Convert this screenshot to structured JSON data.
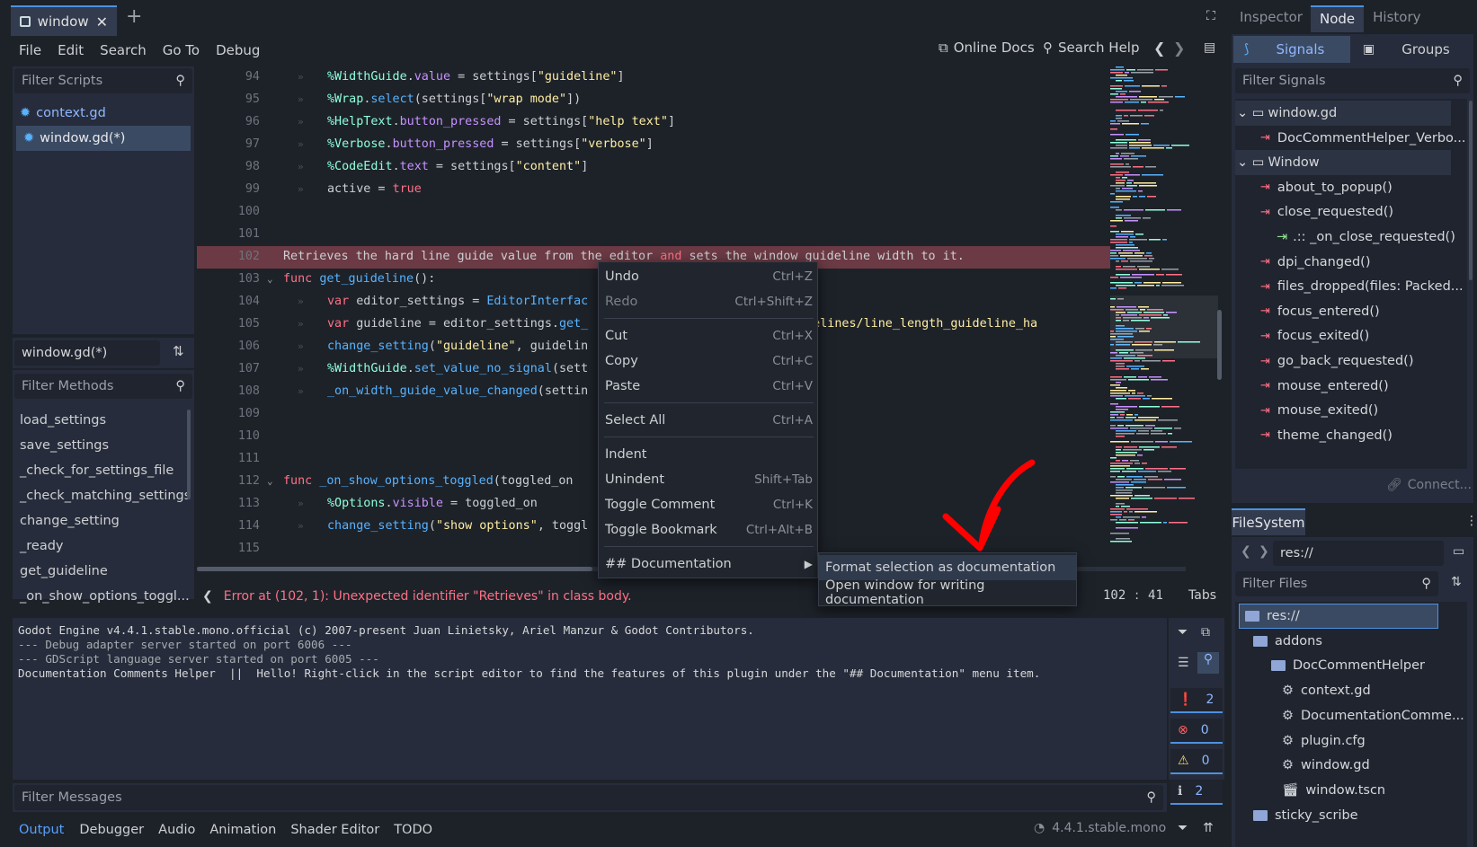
{
  "tabs": {
    "doc_tab": "window",
    "add": "+"
  },
  "menu": [
    "File",
    "Edit",
    "Search",
    "Go To",
    "Debug"
  ],
  "toolbar": {
    "online_docs": "Online Docs",
    "search_help": "Search Help"
  },
  "scripts_panel": {
    "filter_placeholder": "Filter Scripts",
    "items": [
      "context.gd",
      "window.gd(*)"
    ],
    "current": "window.gd(*)",
    "filter_methods": "Filter Methods",
    "methods": [
      "load_settings",
      "save_settings",
      "_check_for_settings_file",
      "_check_matching_settings",
      "change_setting",
      "_ready",
      "get_guideline",
      "_on_show_options_toggl..."
    ]
  },
  "code": {
    "lines": [
      {
        "n": "94",
        "parts": [
          [
            "n",
            "%WidthGuide"
          ],
          [
            "p",
            "."
          ],
          [
            "v",
            "value"
          ],
          [
            "p",
            " = settings["
          ],
          [
            "s",
            "\"guideline\""
          ],
          [
            "p",
            "]"
          ]
        ]
      },
      {
        "n": "95",
        "parts": [
          [
            "n",
            "%Wrap"
          ],
          [
            "p",
            "."
          ],
          [
            "f",
            "select"
          ],
          [
            "p",
            "(settings["
          ],
          [
            "s",
            "\"wrap mode\""
          ],
          [
            "p",
            "])"
          ]
        ]
      },
      {
        "n": "96",
        "parts": [
          [
            "n",
            "%HelpText"
          ],
          [
            "p",
            "."
          ],
          [
            "v",
            "button_pressed"
          ],
          [
            "p",
            " = settings["
          ],
          [
            "s",
            "\"help text\""
          ],
          [
            "p",
            "]"
          ]
        ]
      },
      {
        "n": "97",
        "parts": [
          [
            "n",
            "%Verbose"
          ],
          [
            "p",
            "."
          ],
          [
            "v",
            "button_pressed"
          ],
          [
            "p",
            " = settings["
          ],
          [
            "s",
            "\"verbose\""
          ],
          [
            "p",
            "]"
          ]
        ]
      },
      {
        "n": "98",
        "parts": [
          [
            "n",
            "%CodeEdit"
          ],
          [
            "p",
            "."
          ],
          [
            "v",
            "text"
          ],
          [
            "p",
            " = settings["
          ],
          [
            "s",
            "\"content\""
          ],
          [
            "p",
            "]"
          ]
        ]
      },
      {
        "n": "99",
        "parts": [
          [
            "p",
            "active = "
          ],
          [
            "k",
            "true"
          ]
        ]
      },
      {
        "n": "100",
        "parts": []
      },
      {
        "n": "101",
        "parts": []
      },
      {
        "n": "102",
        "parts": [
          [
            "p",
            "Retrieves the hard line guide value from the editor "
          ],
          [
            "k",
            "and"
          ],
          [
            "p",
            " sets the window guideline width to it."
          ]
        ]
      },
      {
        "n": "103",
        "parts": [
          [
            "k",
            "func "
          ],
          [
            "f",
            "get_guideline"
          ],
          [
            "p",
            "():"
          ]
        ]
      },
      {
        "n": "104",
        "parts": [
          [
            "k",
            "var "
          ],
          [
            "p",
            "editor_settings = "
          ],
          [
            "f",
            "EditorInterfac"
          ]
        ]
      },
      {
        "n": "105",
        "parts": [
          [
            "k",
            "var "
          ],
          [
            "p",
            "guideline = editor_settings."
          ],
          [
            "f",
            "get_"
          ],
          [
            "p",
            "                         "
          ],
          [
            "s",
            "e/guidelines/line_length_guideline_ha"
          ]
        ]
      },
      {
        "n": "106",
        "parts": [
          [
            "f",
            "change_setting"
          ],
          [
            "p",
            "("
          ],
          [
            "s",
            "\"guideline\""
          ],
          [
            "p",
            ", guidelin"
          ]
        ]
      },
      {
        "n": "107",
        "parts": [
          [
            "n",
            "%WidthGuide"
          ],
          [
            "p",
            "."
          ],
          [
            "f",
            "set_value_no_signal"
          ],
          [
            "p",
            "(sett"
          ]
        ]
      },
      {
        "n": "108",
        "parts": [
          [
            "f",
            "_on_width_guide_value_changed"
          ],
          [
            "p",
            "(settin"
          ]
        ]
      },
      {
        "n": "109",
        "parts": []
      },
      {
        "n": "110",
        "parts": []
      },
      {
        "n": "111",
        "parts": []
      },
      {
        "n": "112",
        "parts": [
          [
            "k",
            "func "
          ],
          [
            "f",
            "_on_show_options_toggled"
          ],
          [
            "p",
            "(toggled_on"
          ]
        ]
      },
      {
        "n": "113",
        "parts": [
          [
            "n",
            "%Options"
          ],
          [
            "p",
            "."
          ],
          [
            "v",
            "visible"
          ],
          [
            "p",
            " = toggled_on"
          ]
        ]
      },
      {
        "n": "114",
        "parts": [
          [
            "f",
            "change_setting"
          ],
          [
            "p",
            "("
          ],
          [
            "s",
            "\"show options\""
          ],
          [
            "p",
            ", toggl"
          ]
        ]
      },
      {
        "n": "115",
        "parts": []
      }
    ]
  },
  "status": {
    "error": "Error at (102, 1): Unexpected identifier \"Retrieves\" in class body.",
    "line": "102",
    "sep": ":",
    "col": "41",
    "indent": "Tabs"
  },
  "context_menu": {
    "undo": "Undo",
    "undo_sc": "Ctrl+Z",
    "redo": "Redo",
    "redo_sc": "Ctrl+Shift+Z",
    "cut": "Cut",
    "cut_sc": "Ctrl+X",
    "copy": "Copy",
    "copy_sc": "Ctrl+C",
    "paste": "Paste",
    "paste_sc": "Ctrl+V",
    "select_all": "Select All",
    "select_all_sc": "Ctrl+A",
    "indent": "Indent",
    "unindent": "Unindent",
    "unindent_sc": "Shift+Tab",
    "toggle_comment": "Toggle Comment",
    "toggle_comment_sc": "Ctrl+K",
    "toggle_bookmark": "Toggle Bookmark",
    "toggle_bookmark_sc": "Ctrl+Alt+B",
    "documentation": "## Documentation"
  },
  "submenu": {
    "format": "Format selection as documentation",
    "open_window": "Open window for writing documentation"
  },
  "right_tabs": [
    "Inspector",
    "Node",
    "History"
  ],
  "node_panel": {
    "signals": "Signals",
    "groups": "Groups",
    "filter": "Filter Signals",
    "connect": "Connect...",
    "tree": [
      {
        "label": "window.gd",
        "kind": "header"
      },
      {
        "label": "DocCommentHelper_Verbo...",
        "kind": "signal"
      },
      {
        "label": "Window",
        "kind": "header"
      },
      {
        "label": "about_to_popup()",
        "kind": "signal"
      },
      {
        "label": "close_requested()",
        "kind": "signal"
      },
      {
        "label": ".:: _on_close_requested()",
        "kind": "conn"
      },
      {
        "label": "dpi_changed()",
        "kind": "signal"
      },
      {
        "label": "files_dropped(files: Packed...",
        "kind": "signal"
      },
      {
        "label": "focus_entered()",
        "kind": "signal"
      },
      {
        "label": "focus_exited()",
        "kind": "signal"
      },
      {
        "label": "go_back_requested()",
        "kind": "signal"
      },
      {
        "label": "mouse_entered()",
        "kind": "signal"
      },
      {
        "label": "mouse_exited()",
        "kind": "signal"
      },
      {
        "label": "theme_changed()",
        "kind": "signal"
      }
    ]
  },
  "filesystem": {
    "title": "FileSystem",
    "path": "res://",
    "filter": "Filter Files",
    "tree": [
      "res://",
      "addons",
      "DocCommentHelper",
      "context.gd",
      "DocumentationComme...",
      "plugin.cfg",
      "window.gd",
      "window.tscn",
      "sticky_scribe"
    ]
  },
  "output": {
    "lines": [
      "Godot Engine v4.4.1.stable.mono.official (c) 2007-present Juan Linietsky, Ariel Manzur & Godot Contributors.",
      "--- Debug adapter server started on port 6006 ---",
      "--- GDScript language server started on port 6005 ---",
      "Documentation Comments Helper  ||  Hello! Right-click in the script editor to find the features of this plugin under the \"## Documentation\" menu item."
    ],
    "counts": {
      "messages": "2",
      "errors": "0",
      "warnings": "0",
      "info": "2"
    },
    "filter": "Filter Messages"
  },
  "bottom_tabs": [
    "Output",
    "Debugger",
    "Audio",
    "Animation",
    "Shader Editor",
    "TODO"
  ],
  "version": "4.4.1.stable.mono",
  "colors": {
    "accent": "#4d91e0",
    "error_line": "#6b3a44",
    "arrow": "#ff0000"
  }
}
